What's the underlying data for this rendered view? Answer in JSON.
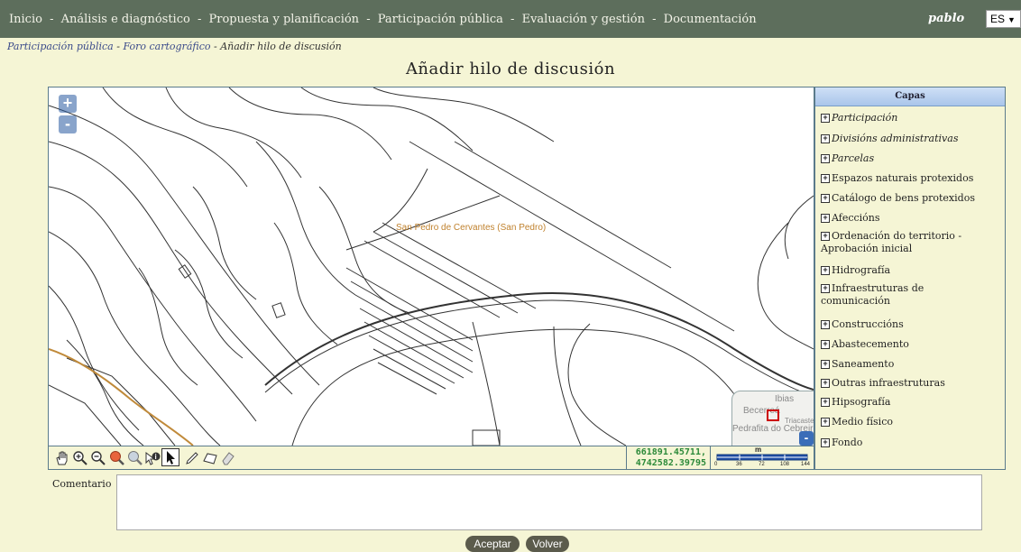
{
  "nav": {
    "items": [
      "Inicio",
      "Análisis e diagnóstico",
      "Propuesta y planificación",
      "Participación pública",
      "Evaluación y gestión",
      "Documentación"
    ],
    "separator": "-"
  },
  "user": {
    "name": "pablo",
    "language": "ES"
  },
  "breadcrumb": {
    "items": [
      "Participación pública",
      "Foro cartográfico",
      "Añadir hilo de discusión"
    ],
    "separator": "-"
  },
  "page": {
    "title": "Añadir hilo de discusión"
  },
  "map": {
    "zoom_in": "+",
    "zoom_out": "-",
    "place_label": "San Pedro de Cervantes (San Pedro)",
    "overview": {
      "labels": [
        "Ibias",
        "Becerreá",
        "Triacastela",
        "Pedrafita do Cebreiro"
      ],
      "toggle": "-"
    },
    "coordinates": {
      "x": "661891.45711,",
      "y": "4742582.39795"
    },
    "scale": {
      "unit": "m",
      "ticks": [
        "0",
        "36",
        "72",
        "108",
        "144"
      ]
    },
    "tools": [
      "pan-icon",
      "zoom-in-icon",
      "zoom-out-icon",
      "zoom-extent-icon",
      "zoom-previous-icon",
      "info-icon",
      "select-icon",
      "draw-line-icon",
      "draw-polygon-icon",
      "eraser-icon"
    ]
  },
  "layers": {
    "title": "Capas",
    "items": [
      {
        "label": "Participación",
        "italic": true
      },
      {
        "label": "Divisións administrativas",
        "italic": true
      },
      {
        "label": "Parcelas",
        "italic": true
      },
      {
        "label": "Espazos naturais protexidos",
        "italic": false
      },
      {
        "label": "Catálogo de bens protexidos",
        "italic": false
      },
      {
        "label": "Afeccións",
        "italic": false
      },
      {
        "label": "Ordenación do territorio - Aprobación inicial",
        "italic": false
      },
      {
        "label": "Hidrografía",
        "italic": false
      },
      {
        "label": "Infraestruturas de comunicación",
        "italic": false
      },
      {
        "label": "Construccións",
        "italic": false
      },
      {
        "label": "Abastecemento",
        "italic": false
      },
      {
        "label": "Saneamento",
        "italic": false
      },
      {
        "label": "Outras infraestruturas",
        "italic": false
      },
      {
        "label": "Hipsografía",
        "italic": false
      },
      {
        "label": "Medio físico",
        "italic": false
      },
      {
        "label": "Fondo",
        "italic": false
      }
    ]
  },
  "form": {
    "comment_label": "Comentario",
    "comment_value": "",
    "accept_label": "Aceptar",
    "back_label": "Volver"
  },
  "colors": {
    "topbar": "#5d6e5c",
    "background": "#f5f5d5",
    "map_border": "#5b7b8b",
    "coords_text": "#2d8a3a",
    "place_label": "#c0822e",
    "button": "#5b5b4c"
  }
}
